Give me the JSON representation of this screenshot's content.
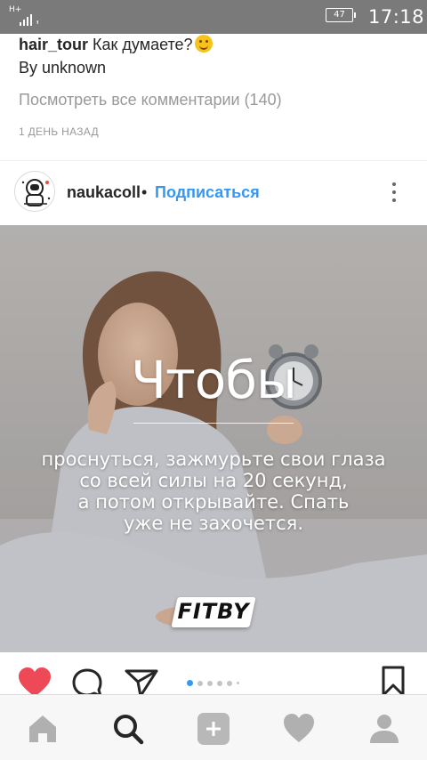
{
  "status_bar": {
    "network_type": "H+",
    "battery_level": "47",
    "time": "17:18"
  },
  "previous_post": {
    "comment_username": "hair_tour",
    "comment_text": "Как думаете?",
    "byline": "By unknown",
    "view_all_comments": "Посмотреть все комментарии (140)",
    "time_ago": "1 ДЕНЬ НАЗАД"
  },
  "post": {
    "username": "naukacoll",
    "separator": "•",
    "follow_label": "Подписаться",
    "image": {
      "title": "Чтобы",
      "body_line1": "проснуться, зажмурьте свои глаза",
      "body_line2": "со всей силы на 20 секунд,",
      "body_line3": "а потом открывайте. Спать",
      "body_line4": "уже не захочется.",
      "brand_logo": "FITBY"
    },
    "liked": true,
    "carousel": {
      "total_dots": 6,
      "active_index": 0
    }
  },
  "icons": {
    "like": "heart-icon",
    "comment": "comment-icon",
    "share": "paper-plane-icon",
    "save": "bookmark-icon",
    "more": "more-vertical-icon"
  },
  "bottom_nav": {
    "items": [
      "home-icon",
      "search-icon",
      "add-icon",
      "activity-icon",
      "profile-icon"
    ],
    "active": "search-icon"
  },
  "colors": {
    "accent_blue": "#3897f0",
    "like_red": "#ed4956",
    "status_bar": "#7a7a7a"
  }
}
